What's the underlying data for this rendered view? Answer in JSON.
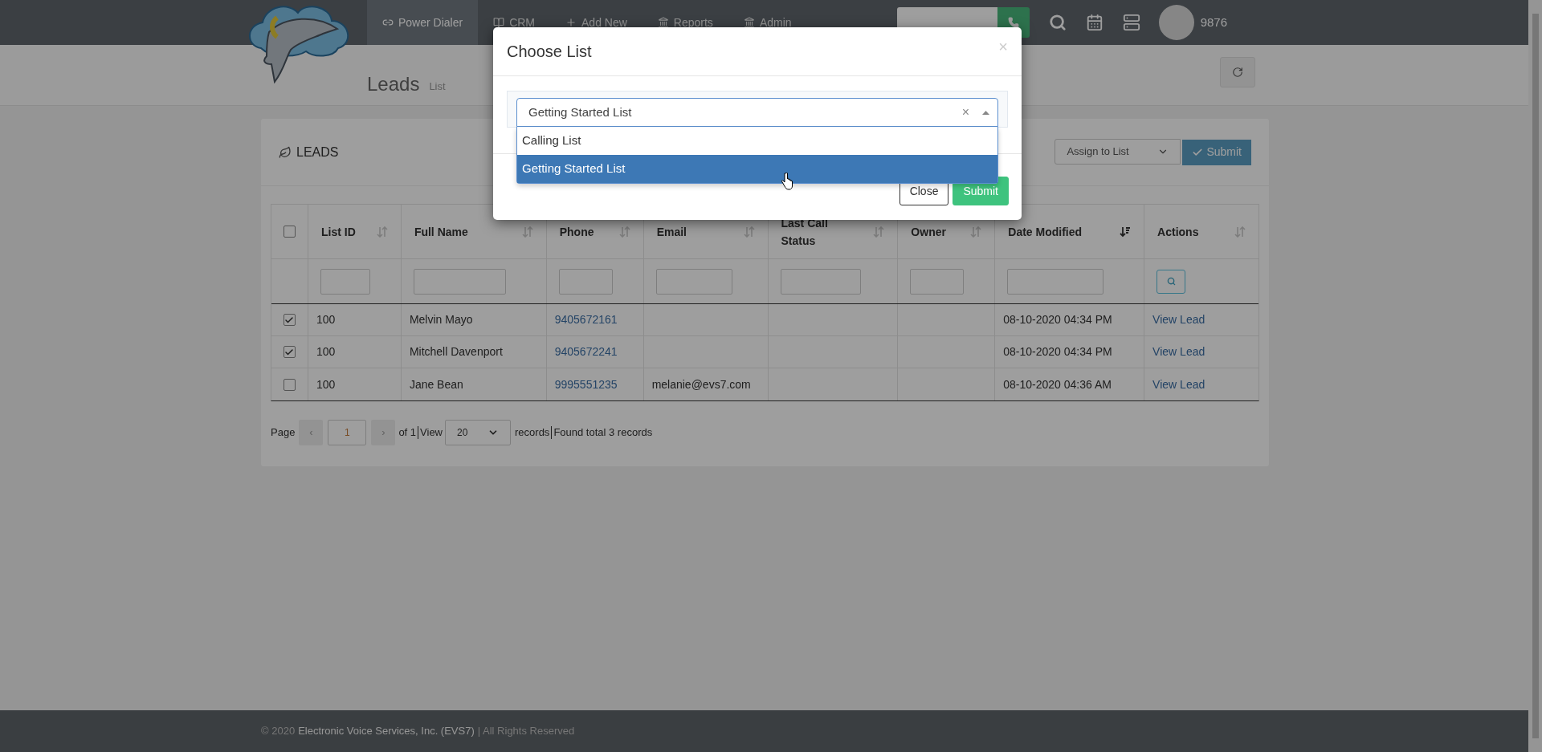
{
  "nav": {
    "items": [
      {
        "label": "Power Dialer",
        "selected": true
      },
      {
        "label": "CRM",
        "selected": false
      },
      {
        "label": "Add New",
        "selected": false
      },
      {
        "label": "Reports",
        "selected": false
      },
      {
        "label": "Admin",
        "selected": false
      }
    ],
    "extension": "9876"
  },
  "page_header": {
    "title": "Leads",
    "subtitle": "List"
  },
  "card": {
    "title": "LEADS",
    "assign_select": "Assign to List",
    "submit": "Submit",
    "table": {
      "select_all": {
        "checked": false
      },
      "columns": [
        {
          "label": "List ID",
          "sorted": false
        },
        {
          "label": "Full Name",
          "sorted": false
        },
        {
          "label": "Phone",
          "sorted": false
        },
        {
          "label": "Email",
          "sorted": false
        },
        {
          "label": "Last Call Status",
          "sorted": false
        },
        {
          "label": "Owner",
          "sorted": false
        },
        {
          "label": "Date Modified",
          "sorted": true
        },
        {
          "label": "Actions",
          "sorted": false
        }
      ],
      "rows": [
        {
          "checked": true,
          "list_id": "100",
          "full_name": "Melvin Mayo",
          "phone": "9405672161",
          "email": "",
          "date_modified": "08-10-2020 04:34 PM",
          "action": "View Lead"
        },
        {
          "checked": true,
          "list_id": "100",
          "full_name": "Mitchell Davenport",
          "phone": "9405672241",
          "email": "",
          "date_modified": "08-10-2020 04:34 PM",
          "action": "View Lead"
        },
        {
          "checked": false,
          "list_id": "100",
          "full_name": "Jane Bean",
          "phone": "9995551235",
          "email": "melanie@evs7.com",
          "date_modified": "08-10-2020 04:36 AM",
          "action": "View Lead"
        }
      ]
    },
    "pagination": {
      "page_label": "Page",
      "prev": "‹",
      "page": "1",
      "next": "›",
      "of": "of 1",
      "view_label": "View",
      "per_page": "20",
      "records_label": "records",
      "found": "Found total 3 records"
    }
  },
  "footer": {
    "year": "© 2020",
    "company": "Electronic Voice Services, Inc. (EVS7)",
    "rights": "| All Rights Reserved"
  },
  "modal": {
    "title": "Choose List",
    "close_glyph": "×",
    "select": {
      "value": "Getting Started List",
      "clear_glyph": "×",
      "open": true
    },
    "options": [
      {
        "label": "Calling List",
        "selected": false
      },
      {
        "label": "Getting Started List",
        "selected": true
      }
    ],
    "buttons": [
      {
        "label": "Close",
        "kind": "default"
      },
      {
        "label": "Submit",
        "kind": "success"
      }
    ]
  }
}
